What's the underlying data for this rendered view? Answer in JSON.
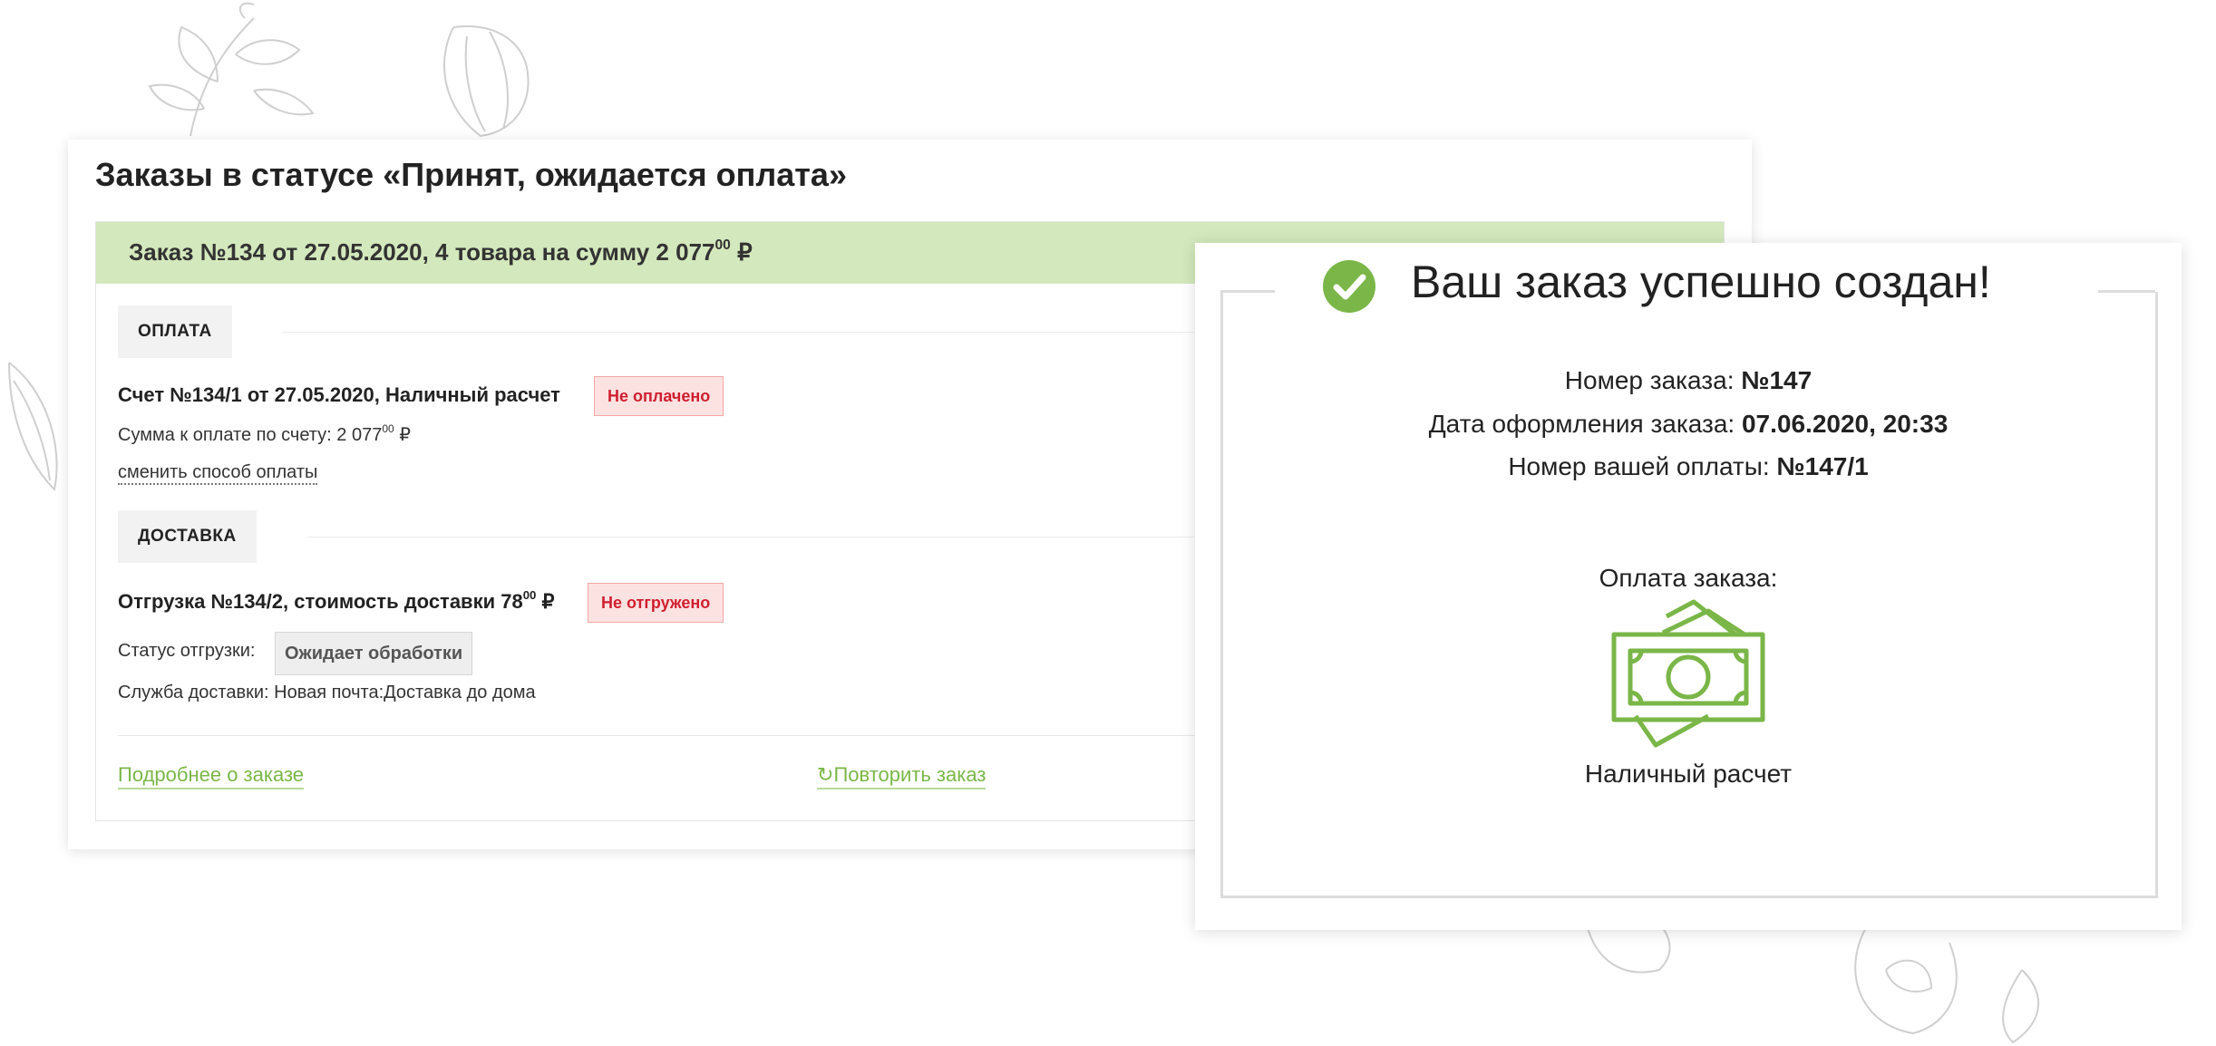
{
  "orders_panel": {
    "title": "Заказы в статусе «Принят, ожидается оплата»",
    "order": {
      "header_prefix": "Заказ №134 от 27.05.2020, 4 товара на сумму 2 077",
      "header_cents": "00",
      "currency": "₽"
    },
    "payment_section": {
      "label": "ОПЛАТА",
      "invoice": "Счет №134/1 от 27.05.2020, Наличный расчет",
      "status_badge": "Не оплачено",
      "amount_prefix": "Сумма к оплате по счету: 2 077",
      "amount_cents": "00",
      "currency": "₽",
      "change_link": "сменить способ оплаты"
    },
    "delivery_section": {
      "label": "ДОСТАВКА",
      "shipment": "Отгрузка №134/2, стоимость доставки 78",
      "shipment_cents": "00",
      "currency": "₽",
      "status_badge": "Не отгружено",
      "shipment_status_label": "Статус отгрузки:",
      "shipment_status_value": "Ожидает обработки",
      "service": "Служба доставки: Новая почта:Доставка до дома"
    },
    "footer": {
      "details_link": "Подробнее о заказе",
      "repeat_icon": "↻",
      "repeat_link": "Повторить заказ"
    }
  },
  "success_panel": {
    "title": "Ваш заказ успешно создан!",
    "order_number_label": "Номер заказа:",
    "order_number_value": "№147",
    "order_date_label": "Дата оформления заказа:",
    "order_date_value": "07.06.2020, 20:33",
    "payment_number_label": "Номер вашей оплаты:",
    "payment_number_value": "№147/1",
    "payment_label": "Оплата заказа:",
    "payment_method": "Наличный расчет",
    "icons": {
      "check": "check-circle-icon",
      "money": "cash-icon"
    }
  },
  "colors": {
    "accent_green": "#7ab648",
    "header_green": "#d3e8bc",
    "status_red": "#d01f2f"
  }
}
